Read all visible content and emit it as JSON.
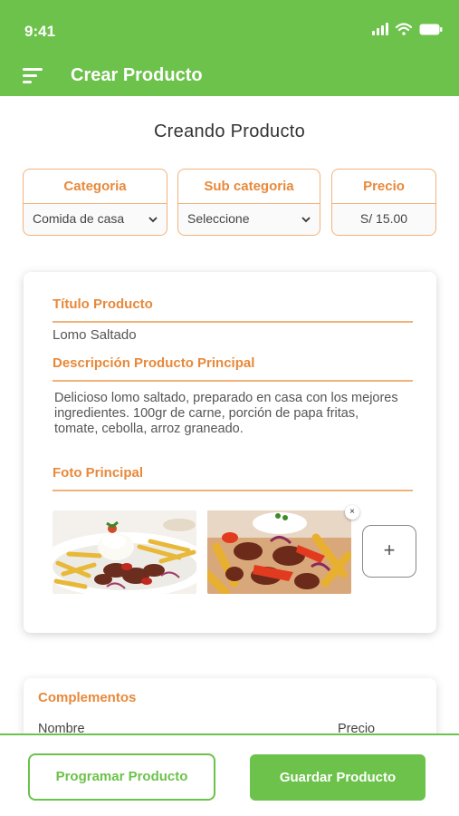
{
  "status_bar": {
    "time": "9:41",
    "icons": [
      "signal-icon",
      "wifi-icon",
      "battery-icon"
    ]
  },
  "app_bar": {
    "title": "Crear Producto",
    "menu_icon": "menu-icon"
  },
  "page": {
    "heading": "Creando Producto"
  },
  "fields": {
    "category": {
      "label": "Categoria",
      "value": "Comida de casa"
    },
    "subcategory": {
      "label": "Sub categoria",
      "value": "Seleccione"
    },
    "price": {
      "label": "Precio",
      "value": "S/ 15.00"
    }
  },
  "product": {
    "title_label": "Título Producto",
    "title_value": "Lomo Saltado",
    "description_label": "Descripción Producto  Principal",
    "description_value": "Delicioso lomo saltado, preparado en casa con los mejores ingredientes. 100gr de carne, porción de papa fritas, tomate, cebolla, arroz graneado.",
    "photo_label": "Foto Principal",
    "remove_photo_symbol": "×",
    "add_photo_symbol": "+"
  },
  "complements": {
    "label": "Complementos",
    "col_name": "Nombre",
    "col_price": "Precio"
  },
  "actions": {
    "schedule": "Programar Producto",
    "save": "Guardar Producto"
  },
  "colors": {
    "primary_green": "#6cc24a",
    "accent_orange": "#e8893a",
    "border_orange": "#f0b27a"
  }
}
